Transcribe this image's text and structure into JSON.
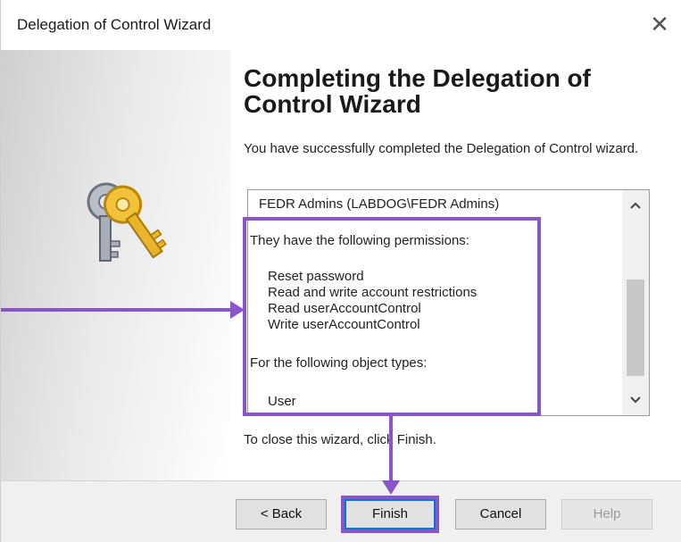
{
  "window": {
    "title": "Delegation of Control Wizard",
    "close_glyph": "✕"
  },
  "main": {
    "heading": "Completing the Delegation of Control Wizard",
    "description": "You have successfully completed the Delegation of Control wizard.",
    "summary_lines": [
      "FEDR Admins (LABDOG\\FEDR Admins)",
      "They have the following permissions:",
      "Reset password",
      "Read and write account restrictions",
      "Read userAccountControl",
      "Write userAccountControl",
      "For the following object types:",
      "User"
    ],
    "close_hint": "To close this wizard, click Finish."
  },
  "buttons": {
    "back": "< Back",
    "finish": "Finish",
    "cancel": "Cancel",
    "help": "Help"
  },
  "icons": {
    "wizard_icon": "keys-icon",
    "scroll_up": "chevron-up-icon",
    "scroll_down": "chevron-down-icon"
  },
  "colors": {
    "annotation": "#8a55c8",
    "finish_border": "#0078d7"
  }
}
